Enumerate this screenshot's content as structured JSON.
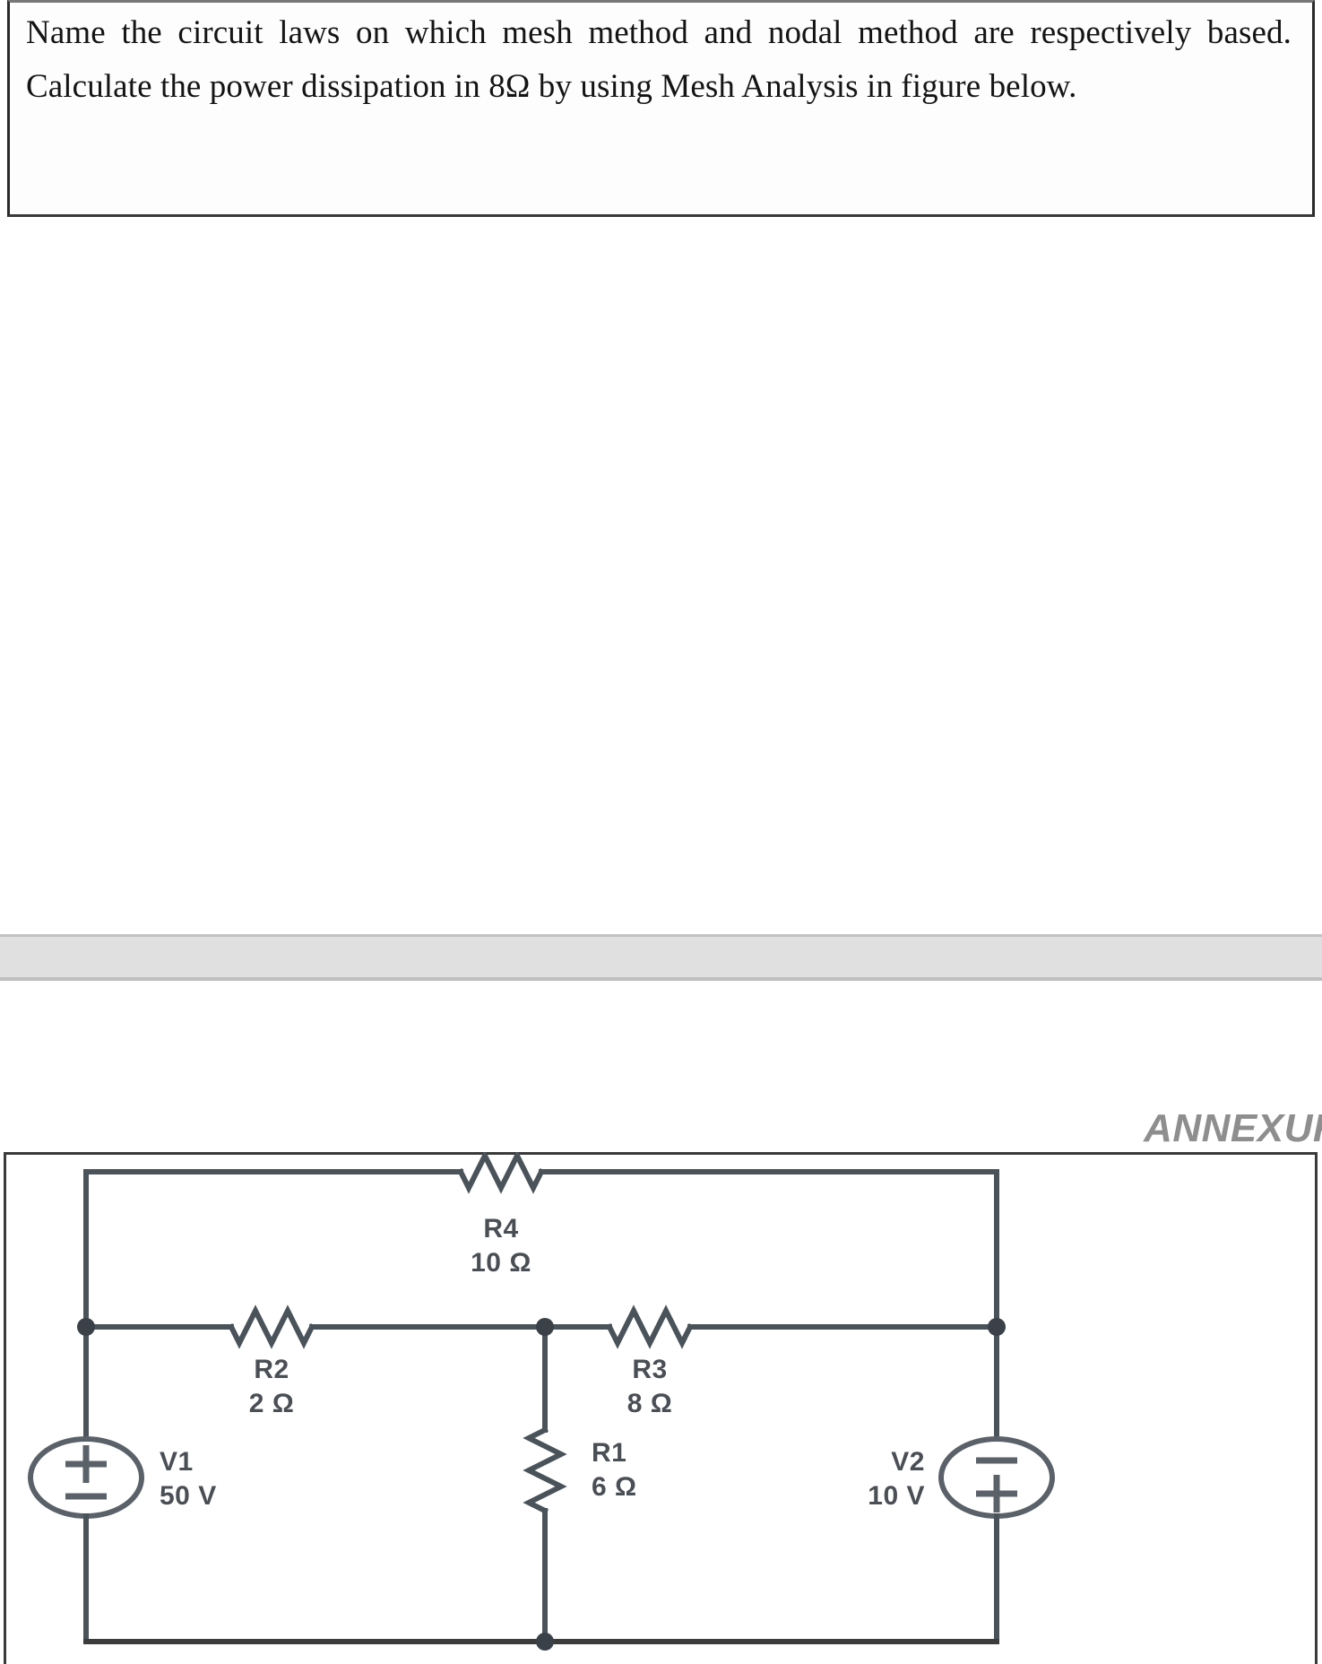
{
  "question": {
    "text": "Name the circuit laws on which mesh method and nodal method are respectively based. Calculate the power dissipation in 8Ω by using Mesh Analysis in figure below."
  },
  "annexure": {
    "heading": "ANNEXURE"
  },
  "circuit": {
    "title": "mesh-analysis-circuit",
    "components": [
      {
        "id": "R4",
        "type": "resistor",
        "orientation": "horizontal",
        "name": "R4",
        "value": "10 Ω"
      },
      {
        "id": "R2",
        "type": "resistor",
        "orientation": "horizontal",
        "name": "R2",
        "value": "2 Ω"
      },
      {
        "id": "R3",
        "type": "resistor",
        "orientation": "horizontal",
        "name": "R3",
        "value": "8 Ω"
      },
      {
        "id": "R1",
        "type": "resistor",
        "orientation": "vertical",
        "name": "R1",
        "value": "6 Ω"
      },
      {
        "id": "V1",
        "type": "voltage-source",
        "name": "V1",
        "value": "50 V",
        "polarity_top": "+",
        "polarity_bottom": "−"
      },
      {
        "id": "V2",
        "type": "voltage-source",
        "name": "V2",
        "value": "10 V",
        "polarity_top": "−",
        "polarity_bottom": "+"
      }
    ],
    "labels": {
      "r4_name": "R4",
      "r4_value": "10 Ω",
      "r2_name": "R2",
      "r2_value": "2 Ω",
      "r3_name": "R3",
      "r3_value": "8 Ω",
      "r1_name": "R1",
      "r1_value": "6 Ω",
      "v1_name": "V1",
      "v1_value": "50 V",
      "v2_name": "V2",
      "v2_value": "10 V"
    }
  },
  "colors": {
    "wire": "#4a525a",
    "text": "#141414",
    "annexure_gray": "#8e8e8e",
    "band_gray": "#e0e0e0",
    "border": "#3a3a3a"
  }
}
